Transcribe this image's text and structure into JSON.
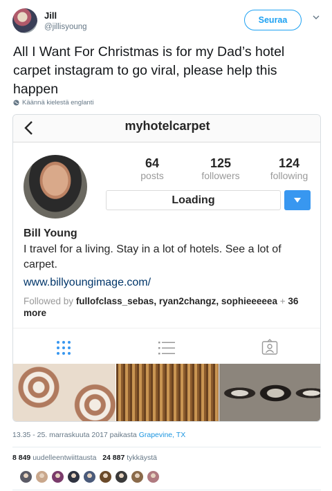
{
  "author": {
    "name": "Jill",
    "handle": "@jillisyoung",
    "follow_label": "Seuraa"
  },
  "tweet": {
    "text": "All I Want For Christmas is for my Dad’s hotel carpet instagram to go viral, please help this happen",
    "translate_label": "Käännä kielestä englanti"
  },
  "instagram": {
    "username": "myhotelcarpet",
    "stats": [
      {
        "value": "64",
        "label": "posts"
      },
      {
        "value": "125",
        "label": "followers"
      },
      {
        "value": "124",
        "label": "following"
      }
    ],
    "action_label": "Loading",
    "bio": {
      "name": "Bill Young",
      "text": "I travel for a living. Stay in a lot of hotels. See a lot of carpet.",
      "link": "www.billyoungimage.com/",
      "followed_prefix": "Followed by",
      "followed_users": "fullofclass_sebas, ryan2changz, sophieeeeea",
      "followed_suffix": "+",
      "followed_more": "36 more"
    }
  },
  "meta": {
    "time": "13.35 - 25. marraskuuta 2017 paikasta",
    "place": "Grapevine, TX",
    "retweets_count": "8 849",
    "retweets_label": "uudelleentwiittausta",
    "likes_count": "24 887",
    "likes_label": "tykkäystä"
  },
  "colors": {
    "accent": "#1da1f2",
    "ig_blue": "#3897f0",
    "muted": "#657786"
  },
  "likers": [
    "#5b5b66",
    "#c9a78c",
    "#7a3b6b",
    "#2f3340",
    "#4a5a7a",
    "#6b4a2a",
    "#3a3a3a",
    "#8a6a4a",
    "#b07a80"
  ]
}
